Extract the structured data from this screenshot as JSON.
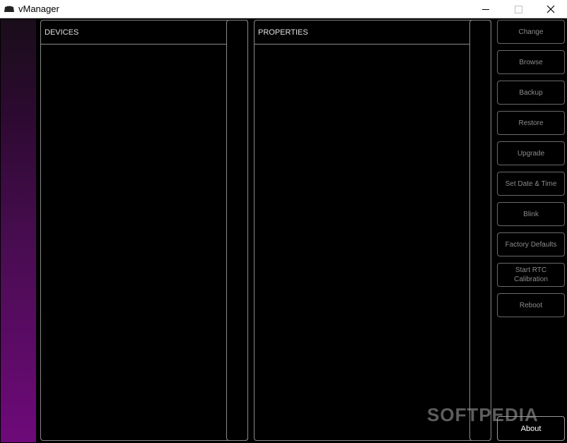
{
  "window": {
    "title": "vManager",
    "icon": "device-icon",
    "controls": [
      "minimize-icon",
      "maximize-icon",
      "close-icon"
    ]
  },
  "panels": {
    "devices": {
      "header": "DEVICES"
    },
    "properties": {
      "header": "PROPERTIES"
    }
  },
  "actions": [
    {
      "label": "Change"
    },
    {
      "label": "Browse"
    },
    {
      "label": "Backup"
    },
    {
      "label": "Restore"
    },
    {
      "label": "Upgrade"
    },
    {
      "label": "Set Date & Time"
    },
    {
      "label": "Blink"
    },
    {
      "label": "Factory Defaults"
    },
    {
      "label": "Start RTC\nCalibration"
    },
    {
      "label": "Reboot"
    }
  ],
  "about_label": "About",
  "watermark": "SOFTPEDIA",
  "colors": {
    "background": "#000000",
    "side_gradient_top": "#1a0d1a",
    "side_gradient_bottom": "#6e0a7a",
    "border": "#8a8a8a",
    "disabled_text": "#8c8c8c"
  }
}
